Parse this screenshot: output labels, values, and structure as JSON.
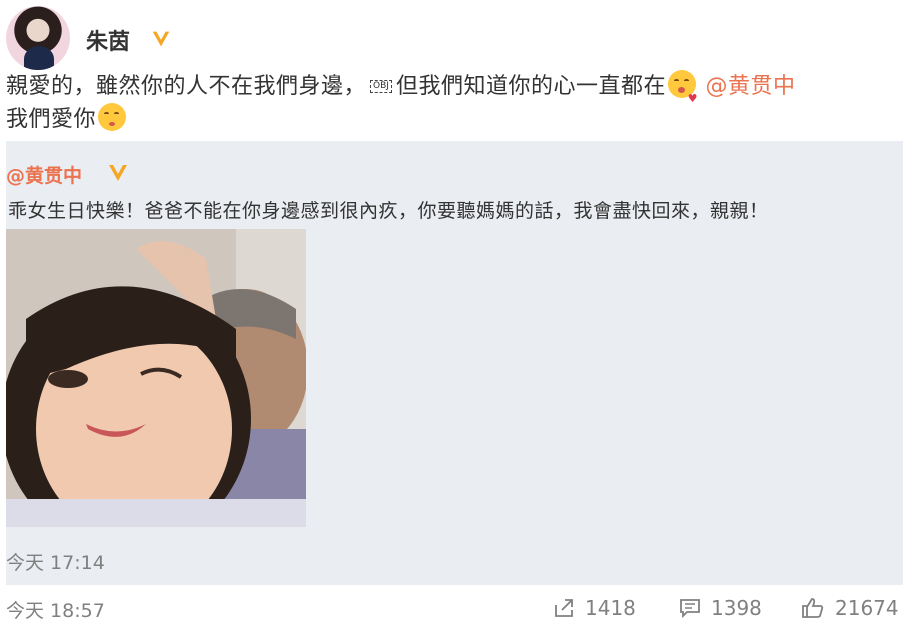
{
  "post": {
    "author": "朱茵",
    "text_part1": "親愛的，雖然你的人不在我們身邊，",
    "obj_marker": "OBJ",
    "text_part2": "但我們知道你的心一直都在",
    "mention": "@黄贯中",
    "text_line2": "我們愛你",
    "emoji1": "kiss-wink-emoji",
    "emoji2": "blush-emoji",
    "time": "今天 18:57",
    "shares": "1418",
    "comments": "1398",
    "likes": "21674"
  },
  "repost": {
    "author": "@黄贯中",
    "text": "乖女生日快樂！爸爸不能在你身邊感到很內疚，你要聽媽媽的話，我會盡快回來，親親！",
    "time": "今天 17:14"
  },
  "colors": {
    "mention": "#eb7350",
    "verified": "#f5a623",
    "repost_bg": "#eaedf2",
    "muted": "#808080"
  }
}
